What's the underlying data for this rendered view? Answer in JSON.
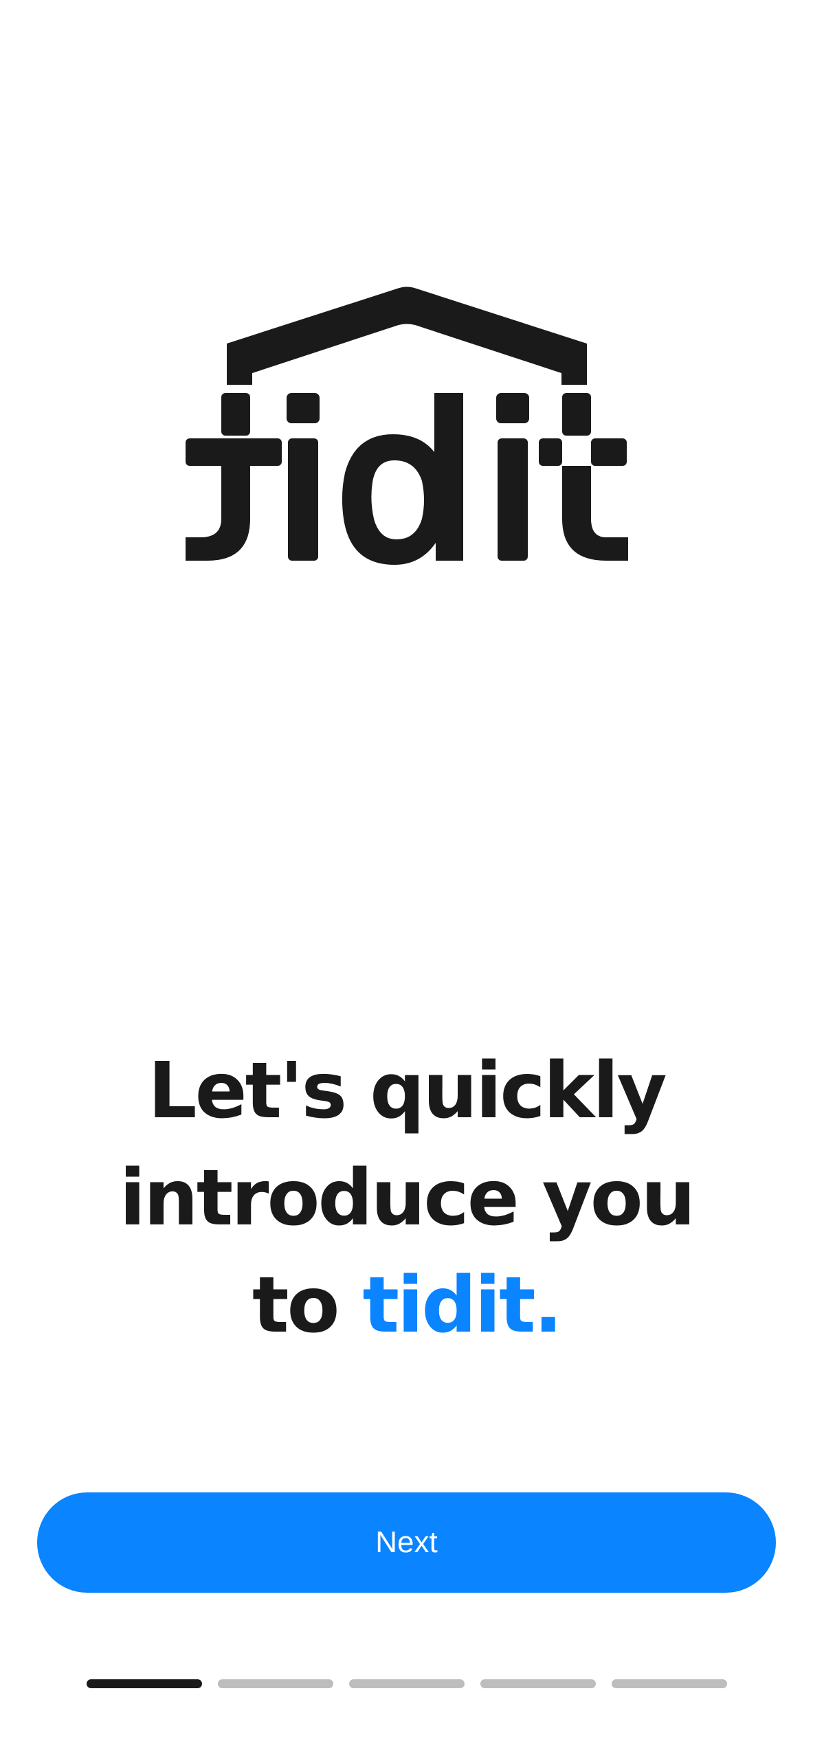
{
  "logo": {
    "wordmark": "tidit",
    "color": "#1a1a1a"
  },
  "headline": {
    "line_1": "Let's quickly",
    "line_2": "introduce you",
    "line_3_prefix": "to",
    "brand": "tidit.",
    "brand_color": "#0a84ff"
  },
  "next_button": {
    "label": "Next",
    "color": "#0a84ff"
  },
  "pagination": {
    "current_page": 1,
    "total_pages": 5
  }
}
